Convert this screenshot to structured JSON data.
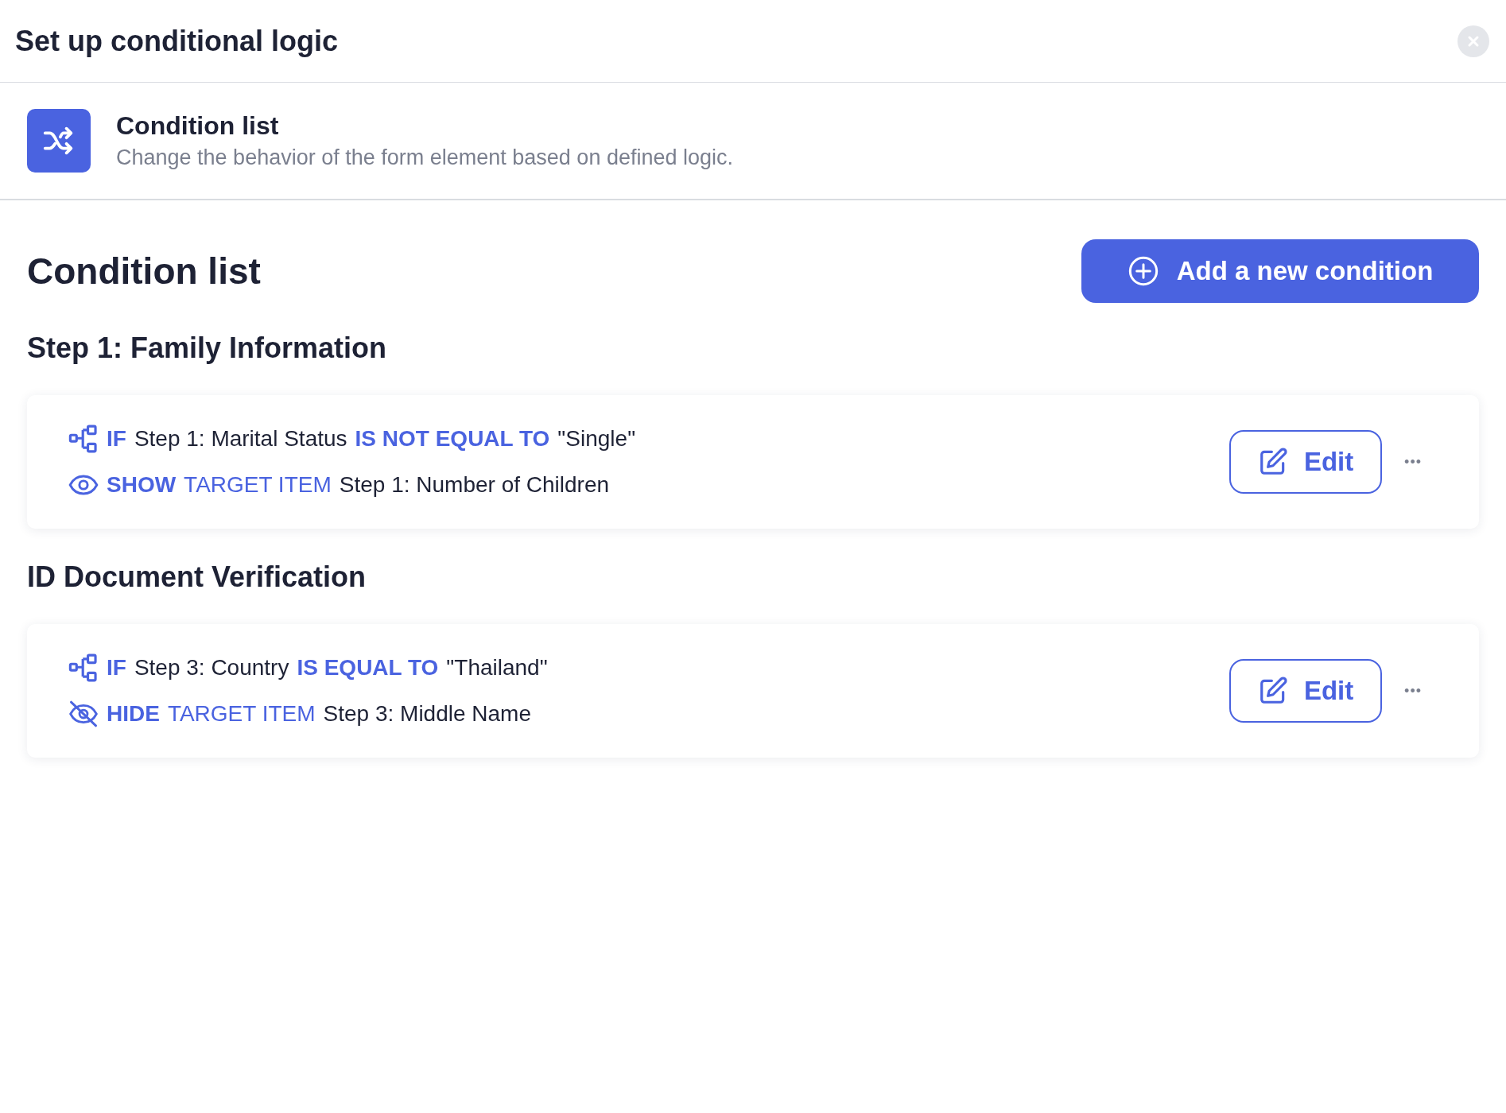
{
  "dialog": {
    "title": "Set up conditional logic"
  },
  "info": {
    "title": "Condition list",
    "description": "Change the behavior of the form element based on defined logic."
  },
  "section": {
    "heading": "Condition list",
    "add_button": "Add a new condition"
  },
  "groups": [
    {
      "heading": "Step 1: Family Information",
      "conditions": [
        {
          "if_keyword": "IF",
          "field": "Step 1: Marital Status",
          "operator": "IS NOT EQUAL TO",
          "value": "\"Single\"",
          "action": "SHOW",
          "kind": "show",
          "target_label": "TARGET ITEM",
          "target": "Step 1: Number of Children",
          "edit_label": "Edit",
          "more": "•••"
        }
      ]
    },
    {
      "heading": "ID Document Verification",
      "conditions": [
        {
          "if_keyword": "IF",
          "field": "Step 3: Country",
          "operator": "IS EQUAL TO",
          "value": "\"Thailand\"",
          "action": "HIDE",
          "kind": "hide",
          "target_label": "TARGET ITEM",
          "target": "Step 3: Middle Name",
          "edit_label": "Edit",
          "more": "•••"
        }
      ]
    }
  ]
}
